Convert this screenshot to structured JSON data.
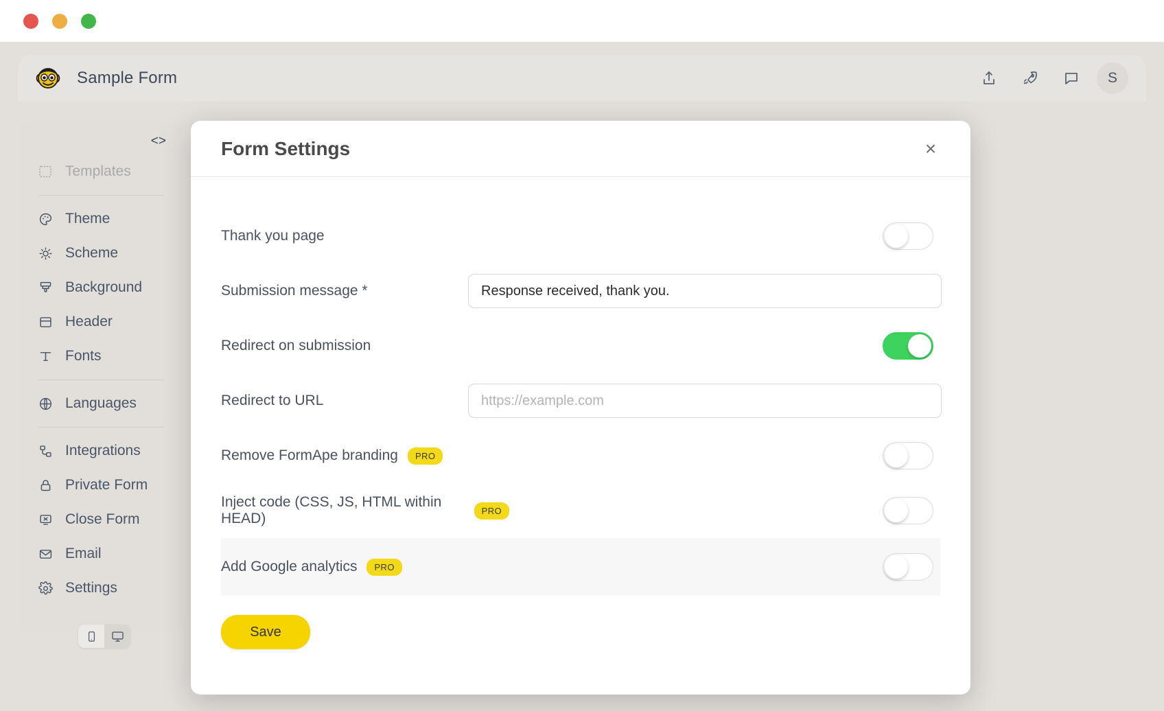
{
  "window": {
    "traffic_lights": [
      "close",
      "minimize",
      "maximize"
    ]
  },
  "toolbar": {
    "logo": "monkey-logo",
    "form_title": "Sample Form",
    "actions": [
      {
        "name": "share-icon",
        "label": "Share"
      },
      {
        "name": "rocket-icon",
        "label": "Publish"
      },
      {
        "name": "comment-icon",
        "label": "Comments"
      }
    ],
    "avatar_initial": "S"
  },
  "sidebar": {
    "code_toggle": "<>",
    "items": [
      {
        "label": "Templates",
        "icon": "templates-icon",
        "disabled": true
      },
      {
        "label": "Theme",
        "icon": "palette-icon",
        "disabled": false
      },
      {
        "label": "Scheme",
        "icon": "brightness-icon",
        "disabled": false
      },
      {
        "label": "Background",
        "icon": "paintbrush-icon",
        "disabled": false
      },
      {
        "label": "Header",
        "icon": "header-icon",
        "disabled": false
      },
      {
        "label": "Fonts",
        "icon": "text-icon",
        "disabled": false
      },
      {
        "label": "Languages",
        "icon": "globe-icon",
        "disabled": false
      },
      {
        "label": "Integrations",
        "icon": "integrations-icon",
        "disabled": false
      },
      {
        "label": "Private Form",
        "icon": "lock-icon",
        "disabled": false
      },
      {
        "label": "Close Form",
        "icon": "close-form-icon",
        "disabled": false
      },
      {
        "label": "Email",
        "icon": "envelope-icon",
        "disabled": false
      },
      {
        "label": "Settings",
        "icon": "gear-icon",
        "disabled": false
      }
    ],
    "device_toggle": {
      "mobile": "mobile-icon",
      "desktop": "desktop-icon",
      "active": "desktop"
    }
  },
  "modal": {
    "title": "Form Settings",
    "close_label": "×",
    "rows": {
      "thank_you_page": {
        "label": "Thank you page",
        "toggle_state": "off"
      },
      "submission_message": {
        "label": "Submission message *",
        "value": "Response received, thank you.",
        "placeholder": ""
      },
      "redirect_on_submission": {
        "label": "Redirect on submission",
        "toggle_state": "on"
      },
      "redirect_to_url": {
        "label": "Redirect to URL",
        "value": "",
        "placeholder": "https://example.com"
      },
      "remove_branding": {
        "label": "Remove FormApe branding",
        "badge": "PRO",
        "toggle_state": "off"
      },
      "inject_code": {
        "label": "Inject code (CSS, JS, HTML within HEAD)",
        "badge": "PRO",
        "toggle_state": "off"
      },
      "google_analytics": {
        "label": "Add Google analytics",
        "badge": "PRO",
        "toggle_state": "off"
      }
    },
    "save_label": "Save"
  },
  "colors": {
    "accent_yellow": "#F5D400",
    "pro_yellow": "#F2D91A",
    "toggle_on_green": "#3DD35E",
    "app_background": "#E3E0DC",
    "sidebar": "#E2DFDB",
    "text": "#4A5160"
  }
}
